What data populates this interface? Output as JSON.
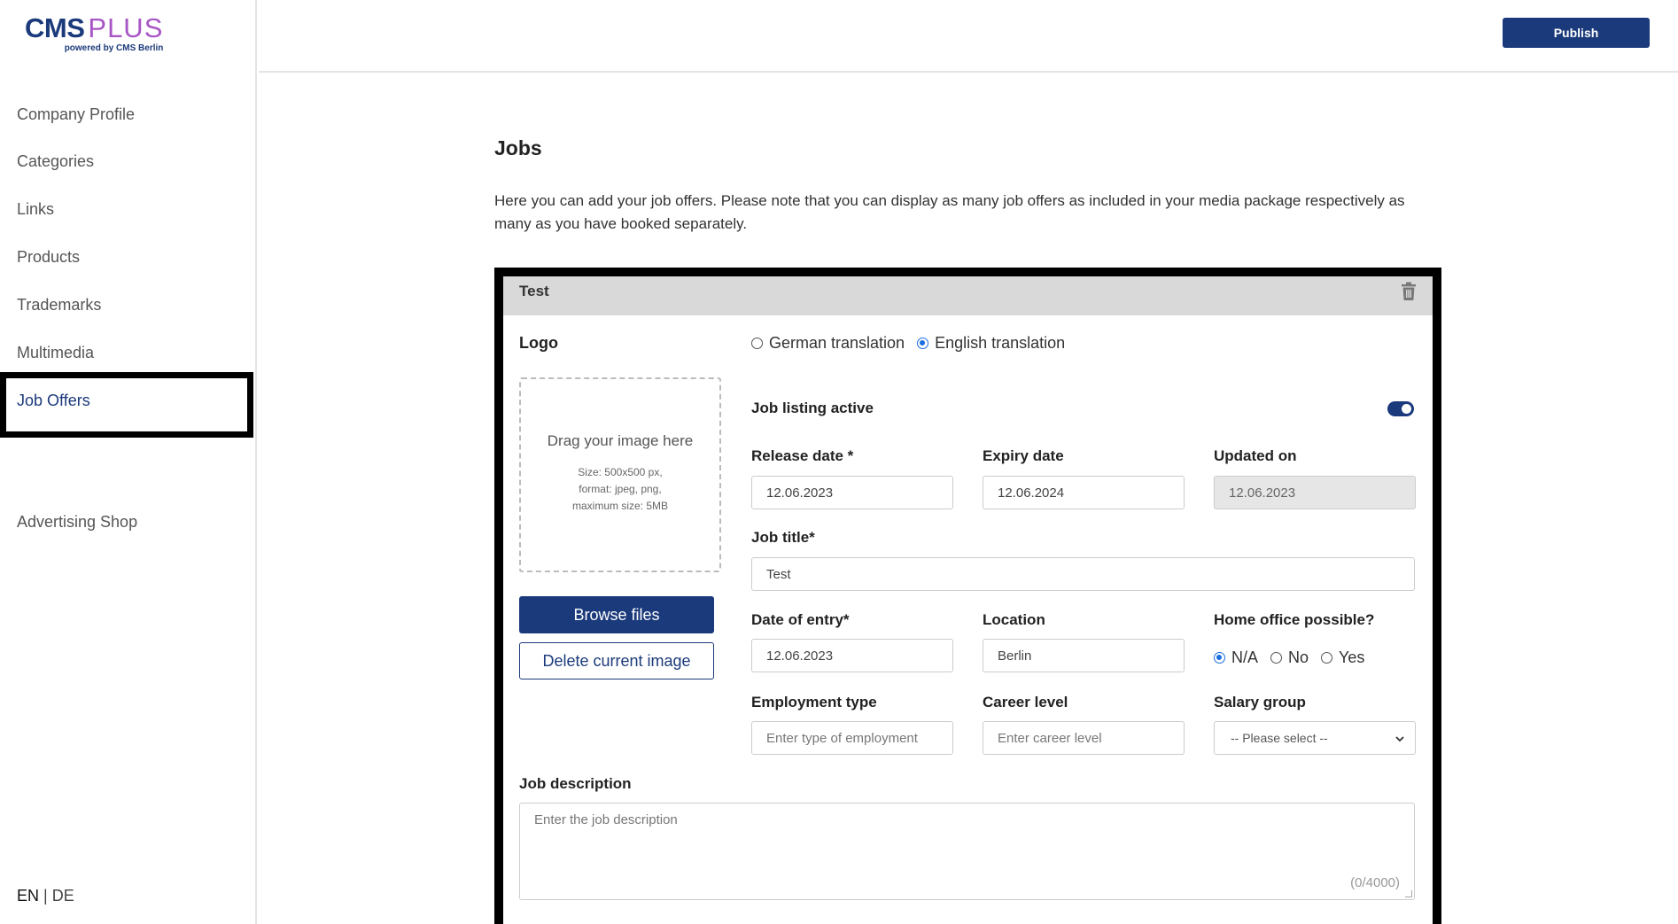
{
  "brand": {
    "name_main": "CMS",
    "name_plus": "PLUS",
    "tagline": "powered by CMS Berlin"
  },
  "sidebar": {
    "items": [
      {
        "label": "Company Profile"
      },
      {
        "label": "Categories"
      },
      {
        "label": "Links"
      },
      {
        "label": "Products"
      },
      {
        "label": "Trademarks"
      },
      {
        "label": "Multimedia"
      },
      {
        "label": "Job Offers",
        "active": true
      }
    ],
    "shop": {
      "label": "Advertising Shop"
    },
    "lang": {
      "en": "EN",
      "sep": "|",
      "de": "DE",
      "selected": "EN"
    }
  },
  "header": {
    "publish_label": "Publish"
  },
  "main": {
    "title": "Jobs",
    "intro": "Here you can add your job offers. Please note that you can display as many job offers as included in your media package respectively as many as you have booked separately."
  },
  "job": {
    "header_title": "Test",
    "logo_label": "Logo",
    "dropzone": {
      "title": "Drag your image here",
      "info_line1": "Size: 500x500 px,",
      "info_line2": "format: jpeg, png,",
      "info_line3": "maximum size: 5MB"
    },
    "browse_label": "Browse files",
    "delete_label": "Delete current image",
    "translation": {
      "options": [
        "German translation",
        "English translation"
      ],
      "selected": "English translation"
    },
    "listing_active_label": "Job listing active",
    "listing_active": true,
    "release_label": "Release date *",
    "release_value": "12.06.2023",
    "expiry_label": "Expiry date",
    "expiry_value": "12.06.2024",
    "updated_label": "Updated on",
    "updated_value": "12.06.2023",
    "title_label": "Job title*",
    "title_value": "Test",
    "entry_label": "Date of entry*",
    "entry_value": "12.06.2023",
    "location_label": "Location",
    "location_value": "Berlin",
    "home_office_label": "Home office possible?",
    "home_office": {
      "options": [
        "N/A",
        "No",
        "Yes"
      ],
      "selected": "N/A"
    },
    "employment_label": "Employment type",
    "employment_placeholder": "Enter type of employment",
    "career_label": "Career level",
    "career_placeholder": "Enter career level",
    "salary_label": "Salary group",
    "salary_selected": "-- Please select --",
    "description_label": "Job description",
    "description_placeholder": "Enter the job description",
    "description_count": "(0/4000)"
  },
  "colors": {
    "brand_navy": "#1b3a7b",
    "brand_purple": "#a855c6",
    "radio_blue": "#1b6ee0",
    "card_header": "#d9d9d9"
  }
}
